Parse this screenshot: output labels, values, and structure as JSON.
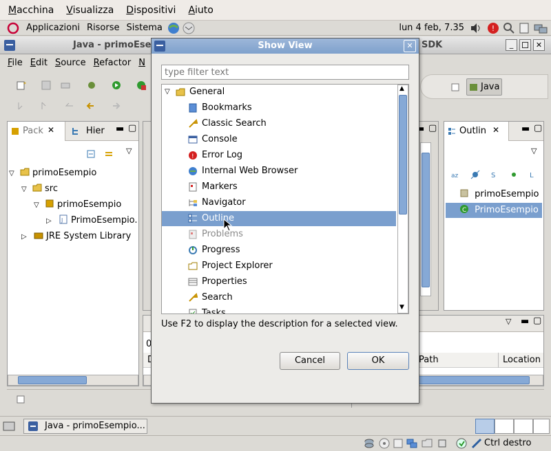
{
  "vbox_menu": [
    "Macchina",
    "Visualizza",
    "Dispositivi",
    "Aiuto"
  ],
  "gnome_panel": {
    "menus": [
      "Applicazioni",
      "Risorse",
      "Sistema"
    ],
    "clock": "lun  4 feb,  7.35"
  },
  "eclipse": {
    "window_title": "Java - primoEse",
    "window_title_right": "SDK",
    "menu": [
      "File",
      "Edit",
      "Source",
      "Refactor",
      "N"
    ],
    "perspective": "Java",
    "left_tabs": [
      "Pack",
      "Hier"
    ],
    "tree": [
      "primoEsempio",
      "src",
      "primoEsempio",
      "PrimoEsempio.",
      "JRE System Library"
    ],
    "outline_tab": "Outlin",
    "outline_items": [
      "primoEsempio",
      "PrimoEsempio"
    ],
    "bottom_cols": [
      "Path",
      "Location"
    ],
    "bottom_small": [
      "0",
      "D"
    ]
  },
  "dialog": {
    "title": "Show View",
    "filter_placeholder": "type filter text",
    "category": "General",
    "items": [
      "Bookmarks",
      "Classic Search",
      "Console",
      "Error Log",
      "Internal Web Browser",
      "Markers",
      "Navigator",
      "Outline",
      "Problems",
      "Progress",
      "Project Explorer",
      "Properties",
      "Search",
      "Tasks"
    ],
    "selected": "Outline",
    "hint": "Use F2 to display the description for a selected view.",
    "cancel_label": "Cancel",
    "ok_label": "OK"
  },
  "taskbar": {
    "task": "Java - primoEsempio..."
  },
  "statusbar": {
    "host_key": "Ctrl destro"
  }
}
